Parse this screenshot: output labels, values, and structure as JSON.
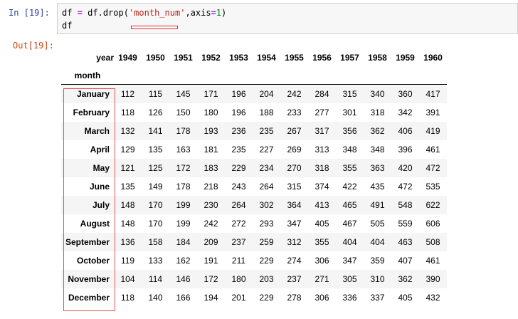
{
  "cell": {
    "in_prompt": "In  [19]:",
    "out_prompt": "Out[19]:",
    "code": {
      "line1_a": "df ",
      "line1_eq": "=",
      "line1_b": " df.drop(",
      "line1_str": "'month_num'",
      "line1_c": ",axis",
      "line1_eq2": "=",
      "line1_num": "1",
      "line1_d": ")",
      "line2": "df"
    }
  },
  "table": {
    "index_header": "year",
    "index_name": "month",
    "columns": [
      "1949",
      "1950",
      "1951",
      "1952",
      "1953",
      "1954",
      "1955",
      "1956",
      "1957",
      "1958",
      "1959",
      "1960"
    ],
    "rows": [
      {
        "month": "January",
        "values": [
          "112",
          "115",
          "145",
          "171",
          "196",
          "204",
          "242",
          "284",
          "315",
          "340",
          "360",
          "417"
        ]
      },
      {
        "month": "February",
        "values": [
          "118",
          "126",
          "150",
          "180",
          "196",
          "188",
          "233",
          "277",
          "301",
          "318",
          "342",
          "391"
        ]
      },
      {
        "month": "March",
        "values": [
          "132",
          "141",
          "178",
          "193",
          "236",
          "235",
          "267",
          "317",
          "356",
          "362",
          "406",
          "419"
        ]
      },
      {
        "month": "April",
        "values": [
          "129",
          "135",
          "163",
          "181",
          "235",
          "227",
          "269",
          "313",
          "348",
          "348",
          "396",
          "461"
        ]
      },
      {
        "month": "May",
        "values": [
          "121",
          "125",
          "172",
          "183",
          "229",
          "234",
          "270",
          "318",
          "355",
          "363",
          "420",
          "472"
        ]
      },
      {
        "month": "June",
        "values": [
          "135",
          "149",
          "178",
          "218",
          "243",
          "264",
          "315",
          "374",
          "422",
          "435",
          "472",
          "535"
        ]
      },
      {
        "month": "July",
        "values": [
          "148",
          "170",
          "199",
          "230",
          "264",
          "302",
          "364",
          "413",
          "465",
          "491",
          "548",
          "622"
        ]
      },
      {
        "month": "August",
        "values": [
          "148",
          "170",
          "199",
          "242",
          "272",
          "293",
          "347",
          "405",
          "467",
          "505",
          "559",
          "606"
        ]
      },
      {
        "month": "September",
        "values": [
          "136",
          "158",
          "184",
          "209",
          "237",
          "259",
          "312",
          "355",
          "404",
          "404",
          "463",
          "508"
        ]
      },
      {
        "month": "October",
        "values": [
          "119",
          "133",
          "162",
          "191",
          "211",
          "229",
          "274",
          "306",
          "347",
          "359",
          "407",
          "461"
        ]
      },
      {
        "month": "November",
        "values": [
          "104",
          "114",
          "146",
          "172",
          "180",
          "203",
          "237",
          "271",
          "305",
          "310",
          "362",
          "390"
        ]
      },
      {
        "month": "December",
        "values": [
          "118",
          "140",
          "166",
          "194",
          "201",
          "229",
          "278",
          "306",
          "336",
          "337",
          "405",
          "432"
        ]
      }
    ]
  },
  "colors": {
    "in_prompt": "#303f9f",
    "out_prompt": "#d84315",
    "annotation": "#e03030",
    "string": "#ba2121"
  }
}
